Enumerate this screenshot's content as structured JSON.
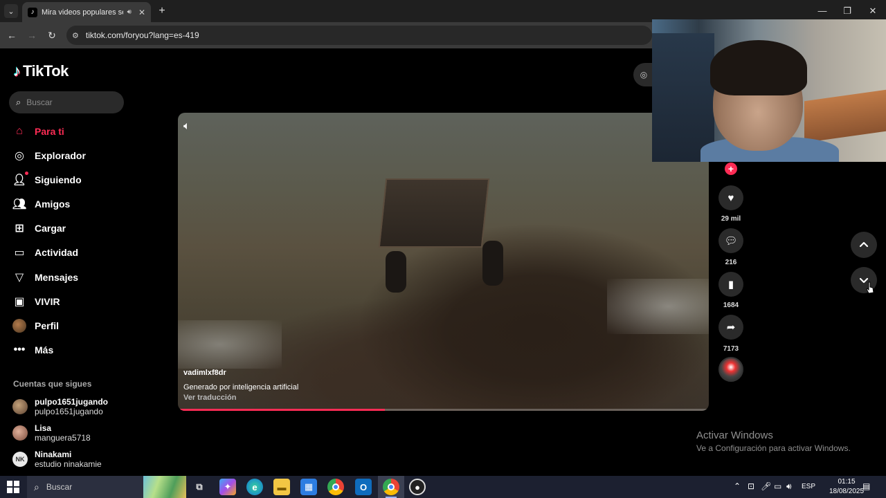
{
  "browser": {
    "tab_title": "Mira videos populares sele",
    "url": "tiktok.com/foryou?lang=es-419"
  },
  "tiktok": {
    "logo_text": "TikTok",
    "search_placeholder": "Buscar",
    "nav": [
      {
        "label": "Para ti",
        "icon": "home-icon",
        "active": true
      },
      {
        "label": "Explorador",
        "icon": "compass-icon"
      },
      {
        "label": "Siguiendo",
        "icon": "following-icon"
      },
      {
        "label": "Amigos",
        "icon": "friends-icon"
      },
      {
        "label": "Cargar",
        "icon": "upload-icon"
      },
      {
        "label": "Actividad",
        "icon": "activity-icon"
      },
      {
        "label": "Mensajes",
        "icon": "messages-icon"
      },
      {
        "label": "VIVIR",
        "icon": "live-icon"
      },
      {
        "label": "Perfil",
        "icon": "profile-avatar"
      },
      {
        "label": "Más",
        "icon": "more-icon"
      }
    ],
    "following_title": "Cuentas que sigues",
    "following": [
      {
        "name": "pulpo1651jugando",
        "handle": "pulpo1651jugando"
      },
      {
        "name": "Lisa",
        "handle": "manguera5718"
      },
      {
        "name": "Ninakami",
        "handle": "estudio ninakamie",
        "initials": "NK"
      }
    ],
    "video": {
      "author": "vadimlxf8dr",
      "caption": "Generado por inteligencia artificial",
      "translate": "Ver traducción",
      "progress": 0.39
    },
    "actions": {
      "likes": "29 mil",
      "comments": "216",
      "saves": "1684",
      "shares": "7173"
    }
  },
  "windows": {
    "activate_title": "Activar Windows",
    "activate_sub": "Ve a Configuración para activar Windows.",
    "taskbar_search_placeholder": "Buscar",
    "language": "ESP",
    "time": "01:15",
    "date": "18/08/2025"
  }
}
